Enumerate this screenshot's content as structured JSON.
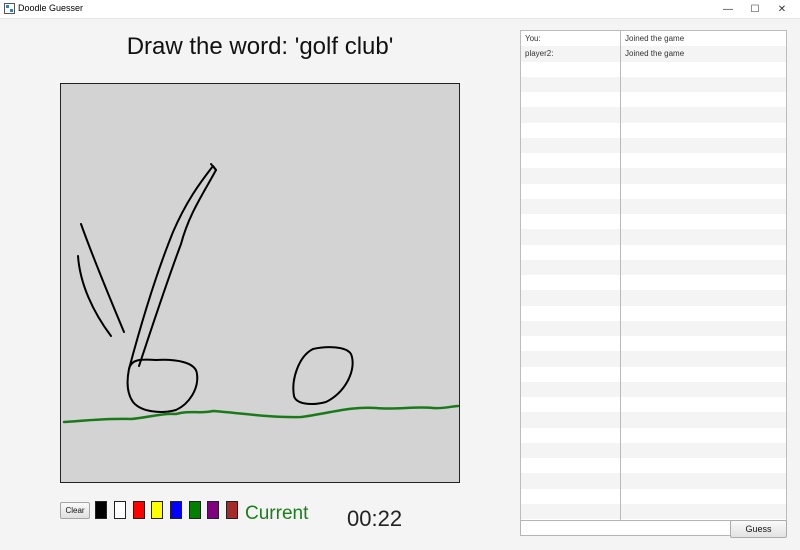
{
  "window": {
    "title": "Doodle Guesser",
    "minimize_glyph": "—",
    "maximize_glyph": "☐",
    "close_glyph": "✕"
  },
  "drawing": {
    "title": "Draw the word: 'golf club'",
    "canvas_background": "#d3d3d3"
  },
  "toolbar": {
    "clear_label": "Clear",
    "swatches": [
      {
        "name": "black",
        "color": "#000000"
      },
      {
        "name": "white",
        "color": "#ffffff"
      },
      {
        "name": "red",
        "color": "#ff0000"
      },
      {
        "name": "yellow",
        "color": "#ffff00"
      },
      {
        "name": "blue",
        "color": "#0000ff"
      },
      {
        "name": "green",
        "color": "#008000"
      },
      {
        "name": "purple",
        "color": "#800080"
      },
      {
        "name": "brown",
        "color": "#a52a2a"
      }
    ],
    "current_label": "Current",
    "current_color": "#1a7f1a",
    "timer": "00:22"
  },
  "chat": {
    "messages": [
      {
        "name": "You:",
        "text": "Joined the game"
      },
      {
        "name": "player2:",
        "text": "Joined the game"
      }
    ],
    "input_value": "",
    "guess_label": "Guess"
  }
}
